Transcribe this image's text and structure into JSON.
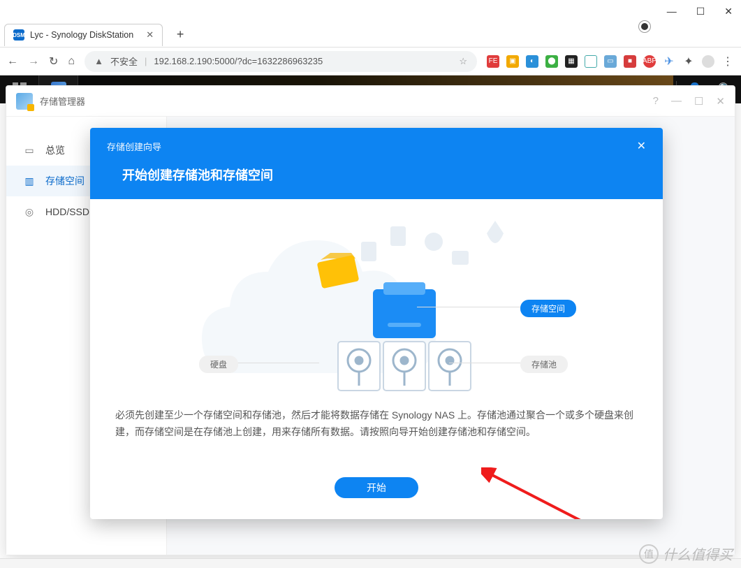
{
  "window_controls": {
    "min": "—",
    "max": "☐",
    "close": "✕"
  },
  "tab": {
    "fav_text": "DSM",
    "title": "Lyc - Synology DiskStation",
    "close": "✕"
  },
  "new_tab": "+",
  "addr": {
    "back": "←",
    "fwd": "→",
    "reload": "↻",
    "home": "⌂",
    "warn_icon": "▲",
    "insecure": "不安全",
    "sep": "|",
    "url": "192.168.2.190:5000/?dc=1632286963235",
    "star": "☆"
  },
  "dsm_top": {
    "user": "👤",
    "search": "🔍"
  },
  "app": {
    "title": "存储管理器",
    "wctrls": {
      "help": "?",
      "min": "—",
      "max": "☐",
      "close": "✕"
    }
  },
  "sidebar": {
    "items": [
      {
        "label": "总览",
        "active": false
      },
      {
        "label": "存储空间",
        "active": true
      },
      {
        "label": "HDD/SSD",
        "active": false
      }
    ]
  },
  "wizard": {
    "breadcrumb": "存储创建向导",
    "close": "✕",
    "title": "开始创建存储池和存储空间",
    "labels": {
      "volume": "存储空间",
      "pool": "存储池",
      "disk": "硬盘"
    },
    "desc": "必须先创建至少一个存储空间和存储池，然后才能将数据存储在 Synology NAS 上。存储池通过聚合一个或多个硬盘来创建，而存储空间是在存储池上创建，用来存储所有数据。请按照向导开始创建存储池和存储空间。",
    "start": "开始"
  },
  "watermark": {
    "badge": "值",
    "text": "什么值得买"
  }
}
